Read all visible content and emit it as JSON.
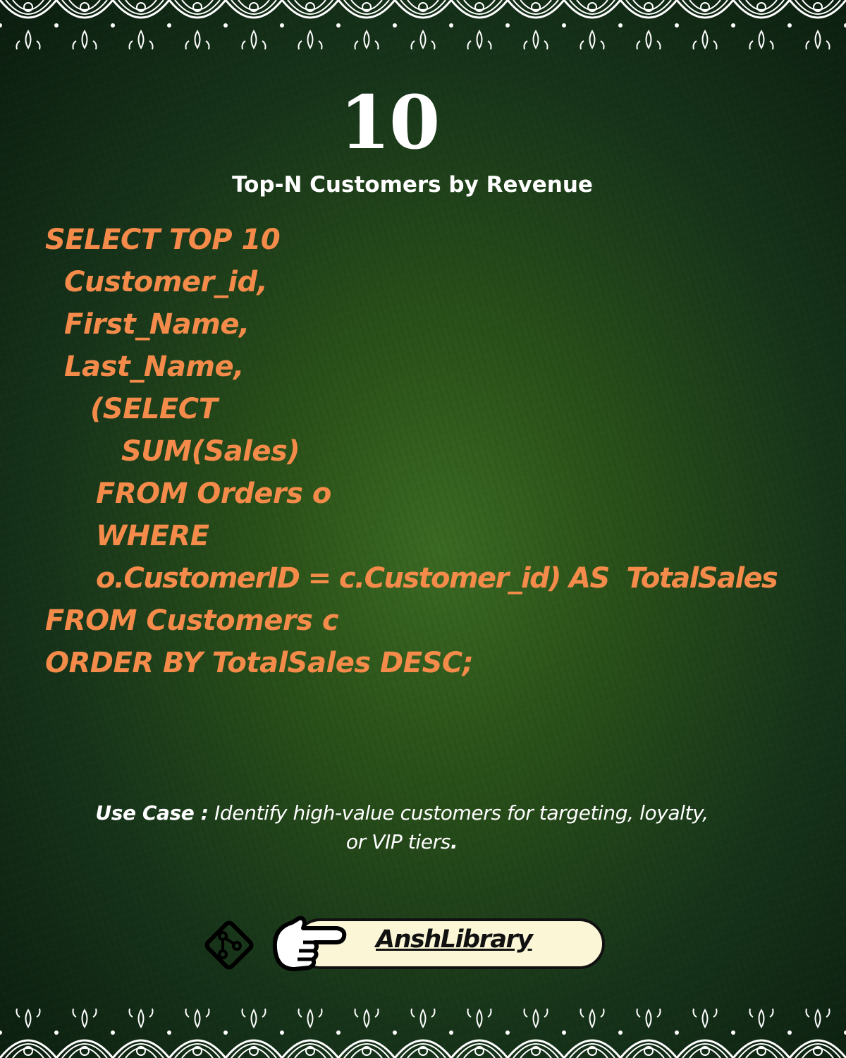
{
  "header": {
    "number": "10",
    "title": "Top-N Customers by Revenue"
  },
  "code": {
    "lines": [
      "SELECT TOP 10",
      "Customer_id,",
      "First_Name,",
      "Last_Name,",
      "(SELECT",
      "SUM(Sales)",
      "FROM Orders o",
      "WHERE",
      "o.CustomerID = c.Customer_id) AS  TotalSales",
      "FROM Customers c",
      "ORDER BY TotalSales DESC;"
    ]
  },
  "use_case": {
    "label": "Use Case :",
    "text": " Identify high-value customers for targeting, loyalty,",
    "text_line2": "or VIP tiers",
    "period": "."
  },
  "footer": {
    "brand": "AnshLibrary",
    "icons": [
      "git-branch-icon",
      "pointing-hand-icon"
    ]
  },
  "colors": {
    "code": "#f58b4a",
    "background": "#2a5119",
    "pill": "#fbf6d6",
    "text": "#ffffff"
  }
}
